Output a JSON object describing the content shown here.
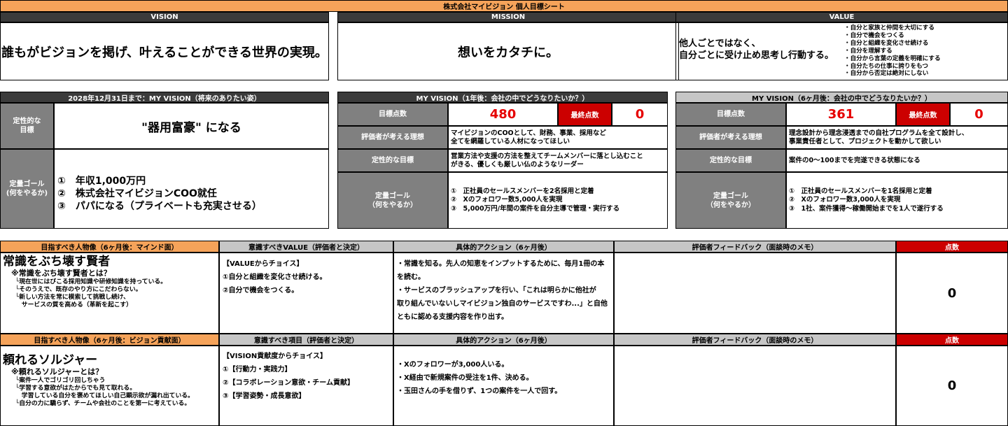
{
  "title": "株式会社マイビジョン 個人目標シート",
  "top": {
    "vision_header": "VISION",
    "mission_header": "MISSION",
    "value_header": "VALUE",
    "vision_text": "誰もがビジョンを掲げ、叶えることができる世界の実現。",
    "mission_text": "想いをカタチに。",
    "value_main": "他人ごとではなく、\n自分ごとに受け止め思考し行動する。",
    "value_list": [
      "・自分と家族と仲間を大切にする",
      "・自分で機会をつくる",
      "・自分と組織を変化させ続ける",
      "・自分を理解する",
      "・自分から言葉の定義を明確にする",
      "・自分たちの仕事に誇りをもつ",
      "・自分から否定は絶対にしない"
    ]
  },
  "my_vision": {
    "header": "2028年12月31日まで：MY VISION（将来のありたい姿）",
    "qual_label": "定性的な\n目標",
    "qual_text": "\"器用富豪\" になる",
    "quant_label": "定量ゴール\n(何をやるか)",
    "quant_items": [
      "①　年収1,000万円",
      "②　株式会社マイビジョンCOO就任",
      "③　パパになる（プライベートも充実させる）"
    ]
  },
  "one_year": {
    "header": "MY VISION（1年後：会社の中でどうなりたいか？）",
    "target_label": "目標点数",
    "target_value": "480",
    "final_label": "最終点数",
    "final_value": "0",
    "ideal_label": "評価者が考える理想",
    "ideal_text": "マイビジョンのCOOとして、財務、事業、採用など\n全てを網羅している人材になってほしい",
    "qual_label": "定性的な目標",
    "qual_text": "営業方法や支援の方法を整えてチームメンバーに落とし込むこと\nがきる、優しくも厳しい仏のようなリーダー",
    "quant_label": "定量ゴール\n（何をやるか）",
    "quant_text": "①　正社員のセールスメンバーを2名採用と定着\n②　Xのフォロワー数5,000人を実現\n③　5,000万円/年間の案件を自分主導で管理・実行する"
  },
  "six_month": {
    "header": "MY VISION（6ヶ月後：会社の中でどうなりたいか？）",
    "target_label": "目標点数",
    "target_value": "361",
    "final_label": "最終点数",
    "final_value": "0",
    "ideal_label": "評価者が考える理想",
    "ideal_text": "理念設計から理念浸透までの自社プログラムを全て設計し、\n事業責任者として、プロジェクトを動かして欲しい",
    "qual_label": "定性的な目標",
    "qual_text": "案件の0〜100までを完遂できる状態になる",
    "quant_label": "定量ゴール\n（何をやるか）",
    "quant_text": "①　正社員のセールスメンバーを1名採用と定着\n②　Xのフォロワー数3,000人を実現\n③　1社、案件獲得〜稼働開始までを1人で遂行する"
  },
  "mind": {
    "h1": "目指すべき人物像（6ヶ月後：マインド面）",
    "h2": "意識すべきVALUE（評価者と決定）",
    "h3": "具体的アクション（6ヶ月後）",
    "h4": "評価者フィードバック（面談時のメモ）",
    "h5": "点数",
    "title": "常識をぶち壊す賢者",
    "sub": "※常識をぶち壊す賢者とは？",
    "desc": "└現在世にはびこる採用知識や研修知識を持っている。\n└そのうえで、既存のやり方にこだわらない。\n└新しい方法を常に模索して挑戦し続け、\n　サービスの質を高める（革新を起こす）",
    "value_text": "【VALUEからチョイス】\n①自分と組織を変化させ続ける。\n②自分で機会をつくる。",
    "action_text": "・常識を知る。先人の知恵をインプットするために、毎月1冊の本\nを読む。\n・サービスのブラッシュアップを行い、「これは明らかに他社が\n取り組んでいないしマイビジョン独自のサービスですわ...」と自他\nともに認める支援内容を作り出す。",
    "feedback": "",
    "score": "0"
  },
  "vision_contrib": {
    "h1": "目指すべき人物像（6ヶ月後：ビジョン貢献面）",
    "h2": "意識すべき項目（評価者と決定）",
    "h3": "具体的アクション（6ヶ月後）",
    "h4": "評価者フィードバック（面談時のメモ）",
    "h5": "点数",
    "title": "頼れるソルジャー",
    "sub": "※頼れるソルジャーとは？",
    "desc": "└案件一人でゴリゴリ回しちゃう\n└学習する意欲がはたからでも見て取れる。\n　学習している自分を褒めてほしい自己顕示欲が漏れ出ている。\n└自分の力に驕らず、チームや会社のことを第一に考えている。",
    "value_text": "【VISION貢献度からチョイス】\n①【行動力・実践力】\n②【コラボレーション意欲・チーム貢献】\n③【学習姿勢・成長意欲】",
    "action_text": "・Xのフォロワーが3,000人いる。\n・X経由で新規案件の受注を1件、決める。\n・玉田さんの手を借りず、1つの案件を一人で回す。",
    "feedback": "",
    "score": "0"
  }
}
